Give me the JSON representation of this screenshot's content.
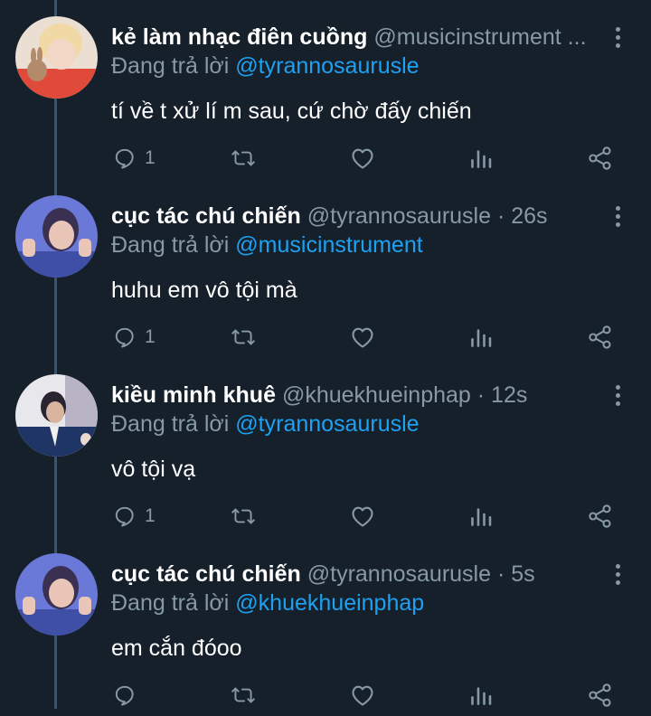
{
  "thread": {
    "tweets": [
      {
        "display_name": "kẻ làm nhạc điên cuồng",
        "handle": "@musicinstrument ...",
        "dot": "",
        "timestamp": "",
        "reply_prefix": "Đang trả lời",
        "reply_to": "@tyrannosaurusle",
        "text": "tí về t xử lí m sau, cứ chờ đấy chiến",
        "reply_count": "1",
        "avatar": "avatar-redhair-bunny"
      },
      {
        "display_name": "cục tác chú chiến",
        "handle": "@tyrannosaurusle",
        "dot": "·",
        "timestamp": "26s",
        "reply_prefix": "Đang trả lời",
        "reply_to": "@musicinstrument",
        "text": "huhu em vô tội mà",
        "reply_count": "1",
        "avatar": "avatar-blue-sweater"
      },
      {
        "display_name": "kiều minh khuê",
        "handle": "@khuekhueinphap",
        "dot": "·",
        "timestamp": "12s",
        "reply_prefix": "Đang trả lời",
        "reply_to": "@tyrannosaurusle",
        "text": "vô tội vạ",
        "reply_count": "1",
        "avatar": "avatar-suit"
      },
      {
        "display_name": "cục tác chú chiến",
        "handle": "@tyrannosaurusle",
        "dot": "·",
        "timestamp": "5s",
        "reply_prefix": "Đang trả lời",
        "reply_to": "@khuekhueinphap",
        "text": "em cắn đóoo",
        "reply_count": "",
        "avatar": "avatar-blue-sweater"
      }
    ]
  },
  "icons": {
    "reply": "reply-bubble-icon",
    "retweet": "retweet-icon",
    "like": "heart-icon",
    "stats": "bar-chart-icon",
    "share": "share-icon",
    "more": "more-vertical-icon"
  },
  "colors": {
    "background": "#15202b",
    "thread_line": "#3d5466",
    "secondary_text": "#8899a6",
    "link": "#1da1f2",
    "primary_text": "#ffffff"
  }
}
